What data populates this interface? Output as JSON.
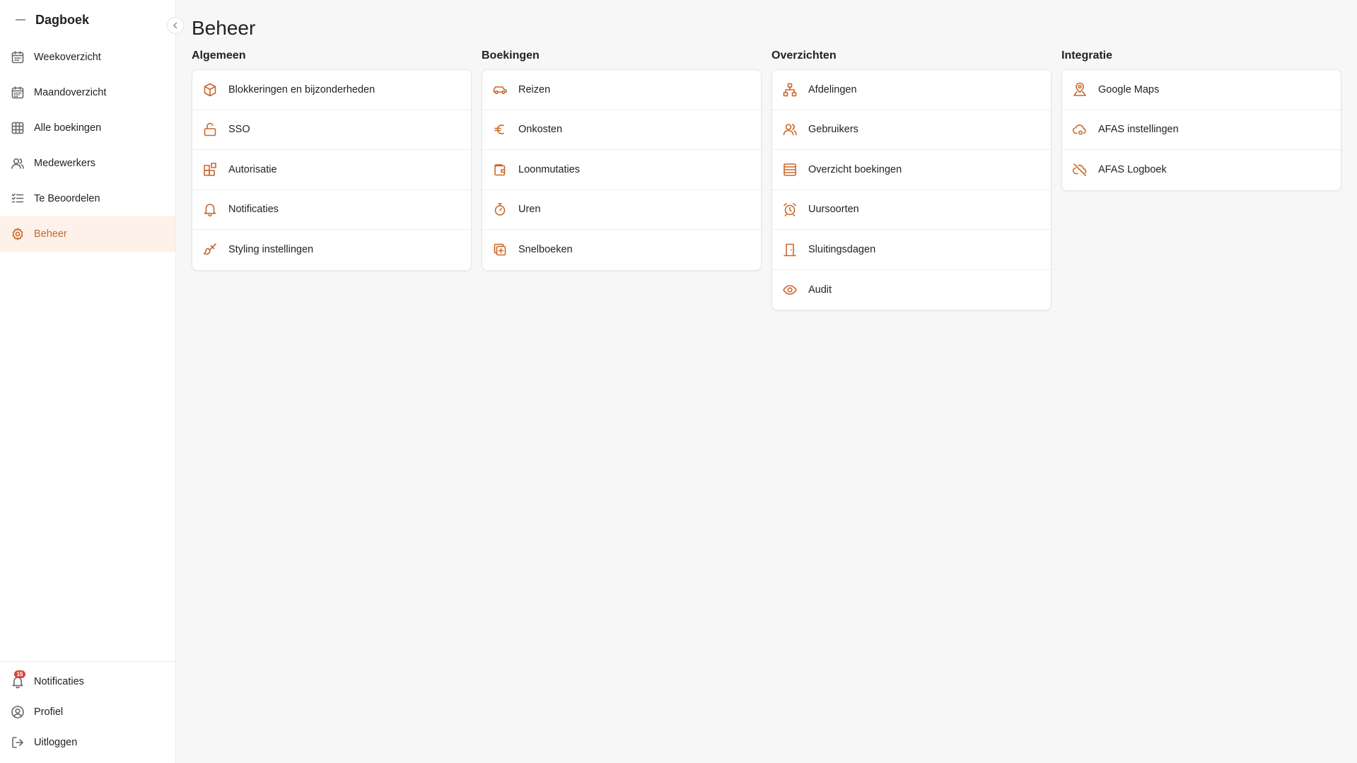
{
  "sidebar": {
    "title": "Dagboek",
    "items": [
      {
        "label": "Weekoverzicht",
        "icon": "calendar-icon"
      },
      {
        "label": "Maandoverzicht",
        "icon": "calendar-month-icon"
      },
      {
        "label": "Alle boekingen",
        "icon": "table-icon"
      },
      {
        "label": "Medewerkers",
        "icon": "users-icon"
      },
      {
        "label": "Te Beoordelen",
        "icon": "checklist-icon"
      },
      {
        "label": "Beheer",
        "icon": "gear-icon",
        "active": true
      }
    ],
    "bottom": {
      "notifications": {
        "label": "Notificaties",
        "badge": "16"
      },
      "profile": {
        "label": "Profiel"
      },
      "logout": {
        "label": "Uitloggen"
      }
    }
  },
  "main": {
    "title": "Beheer",
    "columns": [
      {
        "title": "Algemeen",
        "items": [
          "Blokkeringen en bijzonderheden",
          "SSO",
          "Autorisatie",
          "Notificaties",
          "Styling instellingen"
        ]
      },
      {
        "title": "Boekingen",
        "items": [
          "Reizen",
          "Onkosten",
          "Loonmutaties",
          "Uren",
          "Snelboeken"
        ]
      },
      {
        "title": "Overzichten",
        "items": [
          "Afdelingen",
          "Gebruikers",
          "Overzicht boekingen",
          "Uursoorten",
          "Sluitingsdagen",
          "Audit"
        ]
      },
      {
        "title": "Integratie",
        "items": [
          "Google Maps",
          "AFAS instellingen",
          "AFAS Logboek"
        ]
      }
    ]
  },
  "colors": {
    "accent": "#c9672b",
    "active_bg": "#fdf1ea"
  }
}
